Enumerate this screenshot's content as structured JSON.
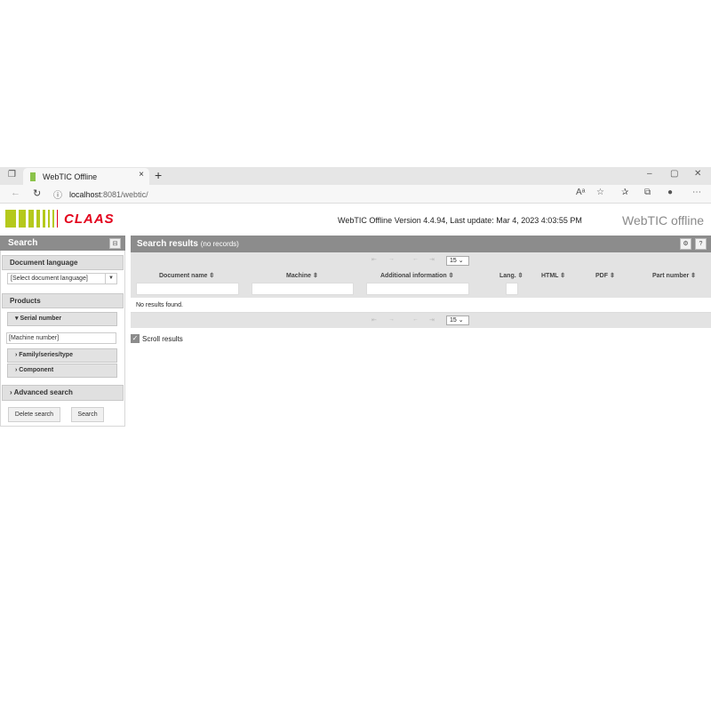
{
  "browser": {
    "tab_title": "WebTIC Offline",
    "tab_close": "×",
    "new_tab": "+",
    "url_host": "localhost",
    "url_path": ":8081/webtic/",
    "min_btn": "–",
    "max_btn": "▢",
    "close_btn": "✕"
  },
  "header": {
    "logo_text": "CLAAS",
    "version_text": "WebTIC Offline Version 4.4.94, Last update: Mar 4, 2023 4:03:55 PM",
    "brand_text": "WebTIC offline"
  },
  "search_panel": {
    "title": "Search",
    "document_language_label": "Document language",
    "document_language_placeholder": "[Select document language]",
    "products_label": "Products",
    "serial_number_label": "Serial number",
    "machine_number_placeholder": "[Machine number]",
    "family_label": "Family/series/type",
    "component_label": "Component",
    "advanced_search_label": "Advanced search",
    "delete_button": "Delete search",
    "search_button": "Search"
  },
  "results": {
    "title": "Search results",
    "note": "(no records)",
    "page_size": "15",
    "columns": [
      "Document name",
      "Machine",
      "Additional information",
      "Lang.",
      "HTML",
      "PDF",
      "Part number"
    ],
    "no_results": "No results found.",
    "scroll_label": "Scroll results"
  },
  "colors": {
    "accent_red": "#e3001b",
    "claas_green": "#b5c91c",
    "header_gray": "#8c8c8c"
  }
}
